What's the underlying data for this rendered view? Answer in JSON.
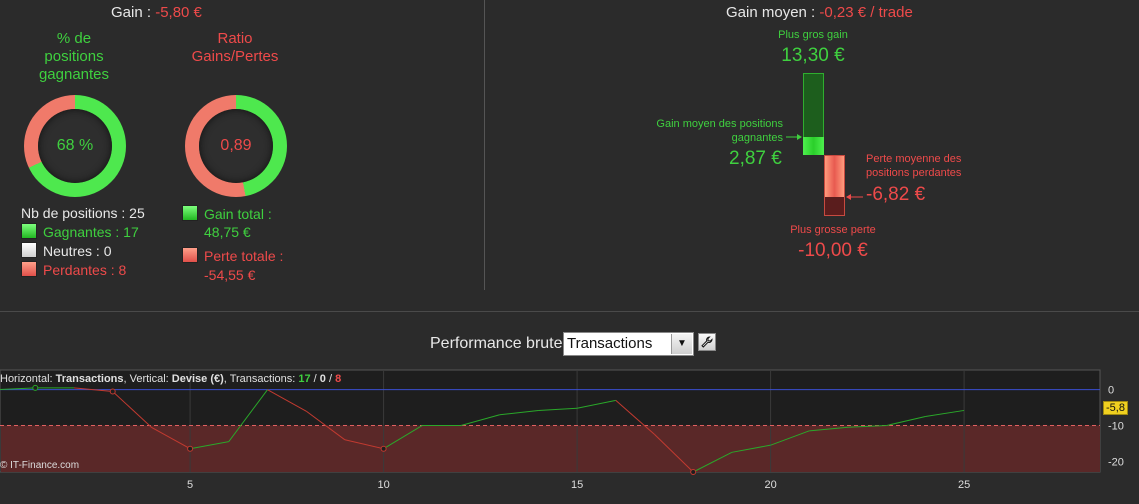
{
  "summary": {
    "gain_label": "Gain :",
    "gain_value": "-5,80 €",
    "win_pct_title": "% de\npositions\ngagnantes",
    "win_pct_value": "68 %",
    "ratio_title": "Ratio\nGains/Pertes",
    "ratio_value": "0,89",
    "nb_positions": "Nb de positions : 25",
    "gagnantes": "Gagnantes : 17",
    "neutres": "Neutres : 0",
    "perdantes": "Perdantes : 8",
    "gain_total_label": "Gain total :",
    "gain_total_value": "48,75 €",
    "perte_totale_label": "Perte totale :",
    "perte_totale_value": "-54,55 €"
  },
  "gain_moyen": {
    "label": "Gain moyen :",
    "value": "-0,23 € / trade",
    "plus_gros_gain_label": "Plus gros gain",
    "plus_gros_gain_value": "13,30 €",
    "gain_moyen_pos_label": "Gain moyen des positions\ngagnantes",
    "gain_moyen_pos_value": "2,87 €",
    "perte_moyenne_label": "Perte moyenne des\npositions perdantes",
    "perte_moyenne_value": "-6,82 €",
    "plus_grosse_perte_label": "Plus grosse perte",
    "plus_grosse_perte_value": "-10,00 €"
  },
  "performance": {
    "label": "Performance brute",
    "select_value": "Transactions",
    "info_prefix_h": "Horizontal: ",
    "info_h_value": "Transactions",
    "info_prefix_v": ", Vertical: ",
    "info_v_value": "Devise (€)",
    "info_prefix_t": ", Transactions: ",
    "info_t_win": "17",
    "info_t_sep1": " / ",
    "info_t_neutral": "0",
    "info_t_sep2": " / ",
    "info_t_loss": "8",
    "copyright": "© IT-Finance.com",
    "last_value_badge": "-5,8"
  },
  "colors": {
    "green": "#3fd03f",
    "red": "#ee4a4a",
    "zero_line": "#3a4fd0"
  },
  "chart_data": {
    "type": "line",
    "x_ticks": [
      5,
      10,
      15,
      20,
      25
    ],
    "y_ticks": [
      0,
      -10,
      -20
    ],
    "ylim": [
      -23,
      5.5
    ],
    "reference_line": -10,
    "series": [
      {
        "x": [
          0,
          1,
          2,
          3,
          4,
          5,
          6,
          7,
          8,
          9,
          10,
          11,
          12,
          13,
          14,
          15,
          16,
          17,
          18,
          19,
          20,
          21,
          22,
          23,
          24,
          25
        ],
        "y": [
          0,
          0.5,
          0.5,
          -0.5,
          -10.5,
          -16.5,
          -14.5,
          0,
          -6,
          -14,
          -16.5,
          -10,
          -10,
          -7,
          -5.8,
          -5.2,
          -3,
          -12.5,
          -23,
          -17.5,
          -15.5,
          -11.5,
          -10.5,
          -10,
          -7.5,
          -5.8
        ]
      }
    ]
  }
}
